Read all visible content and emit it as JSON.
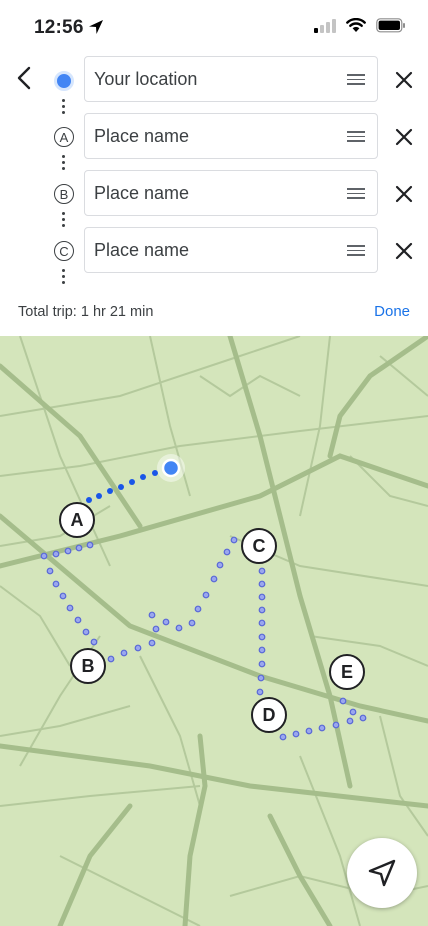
{
  "status_bar": {
    "time": "12:56"
  },
  "stops": [
    {
      "marker": "",
      "marker_type": "current-location",
      "text": "Your location"
    },
    {
      "marker": "A",
      "marker_type": "letter",
      "text": "Place name"
    },
    {
      "marker": "B",
      "marker_type": "letter",
      "text": "Place name"
    },
    {
      "marker": "C",
      "marker_type": "letter",
      "text": "Place name"
    }
  ],
  "trip": {
    "total": "Total trip: 1 hr 21 min",
    "done_label": "Done"
  },
  "map": {
    "pins": [
      "A",
      "B",
      "C",
      "D",
      "E"
    ],
    "colors": {
      "background": "#d4e5bb",
      "road": "#a8bf8f",
      "route_current": "#1a56e8",
      "route_stops": "#7e8fe0"
    }
  },
  "icons": {
    "back": "chevron-left-icon",
    "remove": "close-icon",
    "drag": "drag-handle-icon",
    "my_location": "navigation-arrow-icon"
  }
}
